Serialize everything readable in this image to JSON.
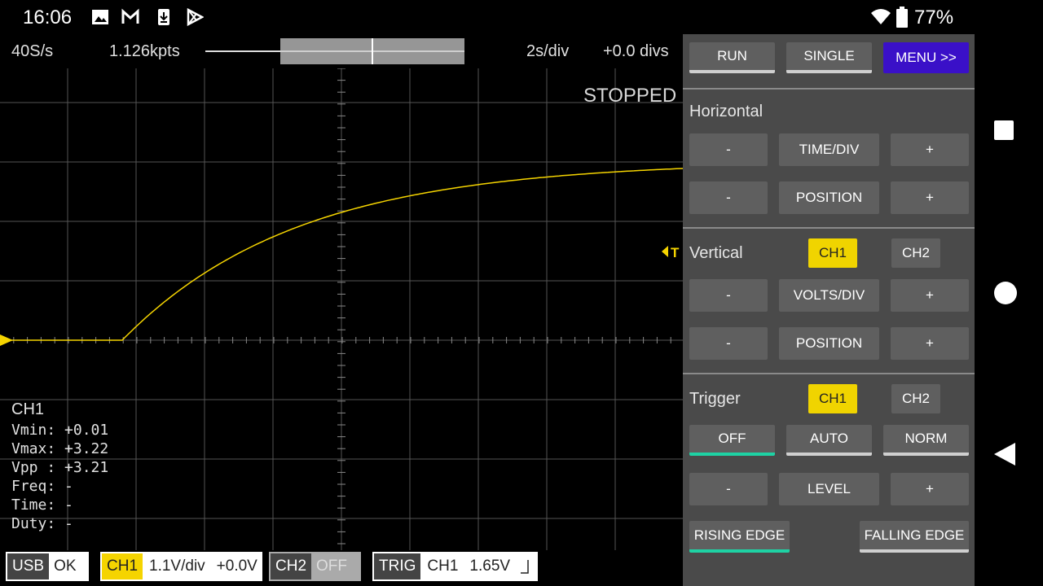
{
  "status_bar": {
    "time": "16:06",
    "notification_icons": [
      "image-icon",
      "gmail-icon",
      "download-icon",
      "play-store-icon"
    ],
    "wifi_icon": "wifi-icon",
    "battery_icon": "battery-icon",
    "battery": "77%"
  },
  "scope": {
    "sample_rate": "40S/s",
    "points": "1.126kpts",
    "time_div": "2s/div",
    "offset": "+0.0 divs",
    "state": "STOPPED",
    "trigger_marker": "T",
    "colors": {
      "trace": "#f5d400",
      "grid": "#555555"
    }
  },
  "measurements": {
    "channel": "CH1",
    "vmin": "Vmin: +0.01",
    "vmax": "Vmax: +3.22",
    "vpp": "Vpp : +3.21",
    "freq": "Freq: -",
    "time": "Time: -",
    "duty": "Duty: -"
  },
  "bottom_bar": {
    "usb_label": "USB",
    "usb_status": "OK",
    "ch1_label": "CH1",
    "ch1_info": "1.1V/div",
    "ch1_offset": "+0.0V",
    "ch2_label": "CH2",
    "ch2_status": "OFF",
    "trig_label": "TRIG",
    "trig_source": "CH1",
    "trig_level": "1.65V"
  },
  "panel": {
    "run": "RUN",
    "single": "SINGLE",
    "menu": "MENU >>",
    "horizontal_title": "Horizontal",
    "minus": "-",
    "plus": "+",
    "time_div": "TIME/DIV",
    "position": "POSITION",
    "vertical_title": "Vertical",
    "ch1": "CH1",
    "ch2": "CH2",
    "volts_div": "VOLTS/DIV",
    "trigger_title": "Trigger",
    "off": "OFF",
    "auto": "AUTO",
    "norm": "NORM",
    "level": "LEVEL",
    "rising_edge": "RISING EDGE",
    "falling_edge": "FALLING EDGE"
  },
  "nav": {
    "recent_icon": "square-icon",
    "home_icon": "circle-icon",
    "back_icon": "back-triangle-icon"
  }
}
